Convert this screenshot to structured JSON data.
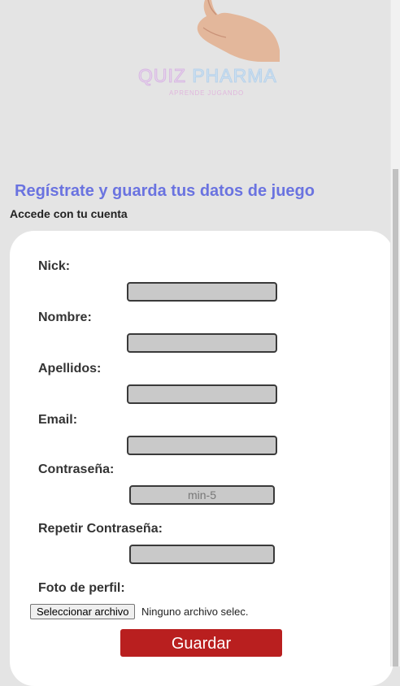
{
  "logo": {
    "title_part1": "QUIZ",
    "title_part2": " PHARMA",
    "tagline": "APRENDE JUGANDO"
  },
  "page": {
    "heading": "Regístrate y guarda tus datos de juego",
    "subheading": "Accede con tu cuenta"
  },
  "form": {
    "nick_label": "Nick:",
    "nombre_label": "Nombre:",
    "apellidos_label": "Apellidos:",
    "email_label": "Email:",
    "password_label": "Contraseña:",
    "password_placeholder": "min-5",
    "repeat_password_label": "Repetir Contraseña:",
    "photo_label": "Foto de perfil:",
    "file_button": "Seleccionar archivo",
    "file_status": "Ninguno archivo selec.",
    "submit_label": "Guardar"
  },
  "colors": {
    "heading": "#6a73e0",
    "submit": "#b91f1f",
    "input_bg": "#c9c9c9",
    "page_bg": "#e4e4e4"
  }
}
